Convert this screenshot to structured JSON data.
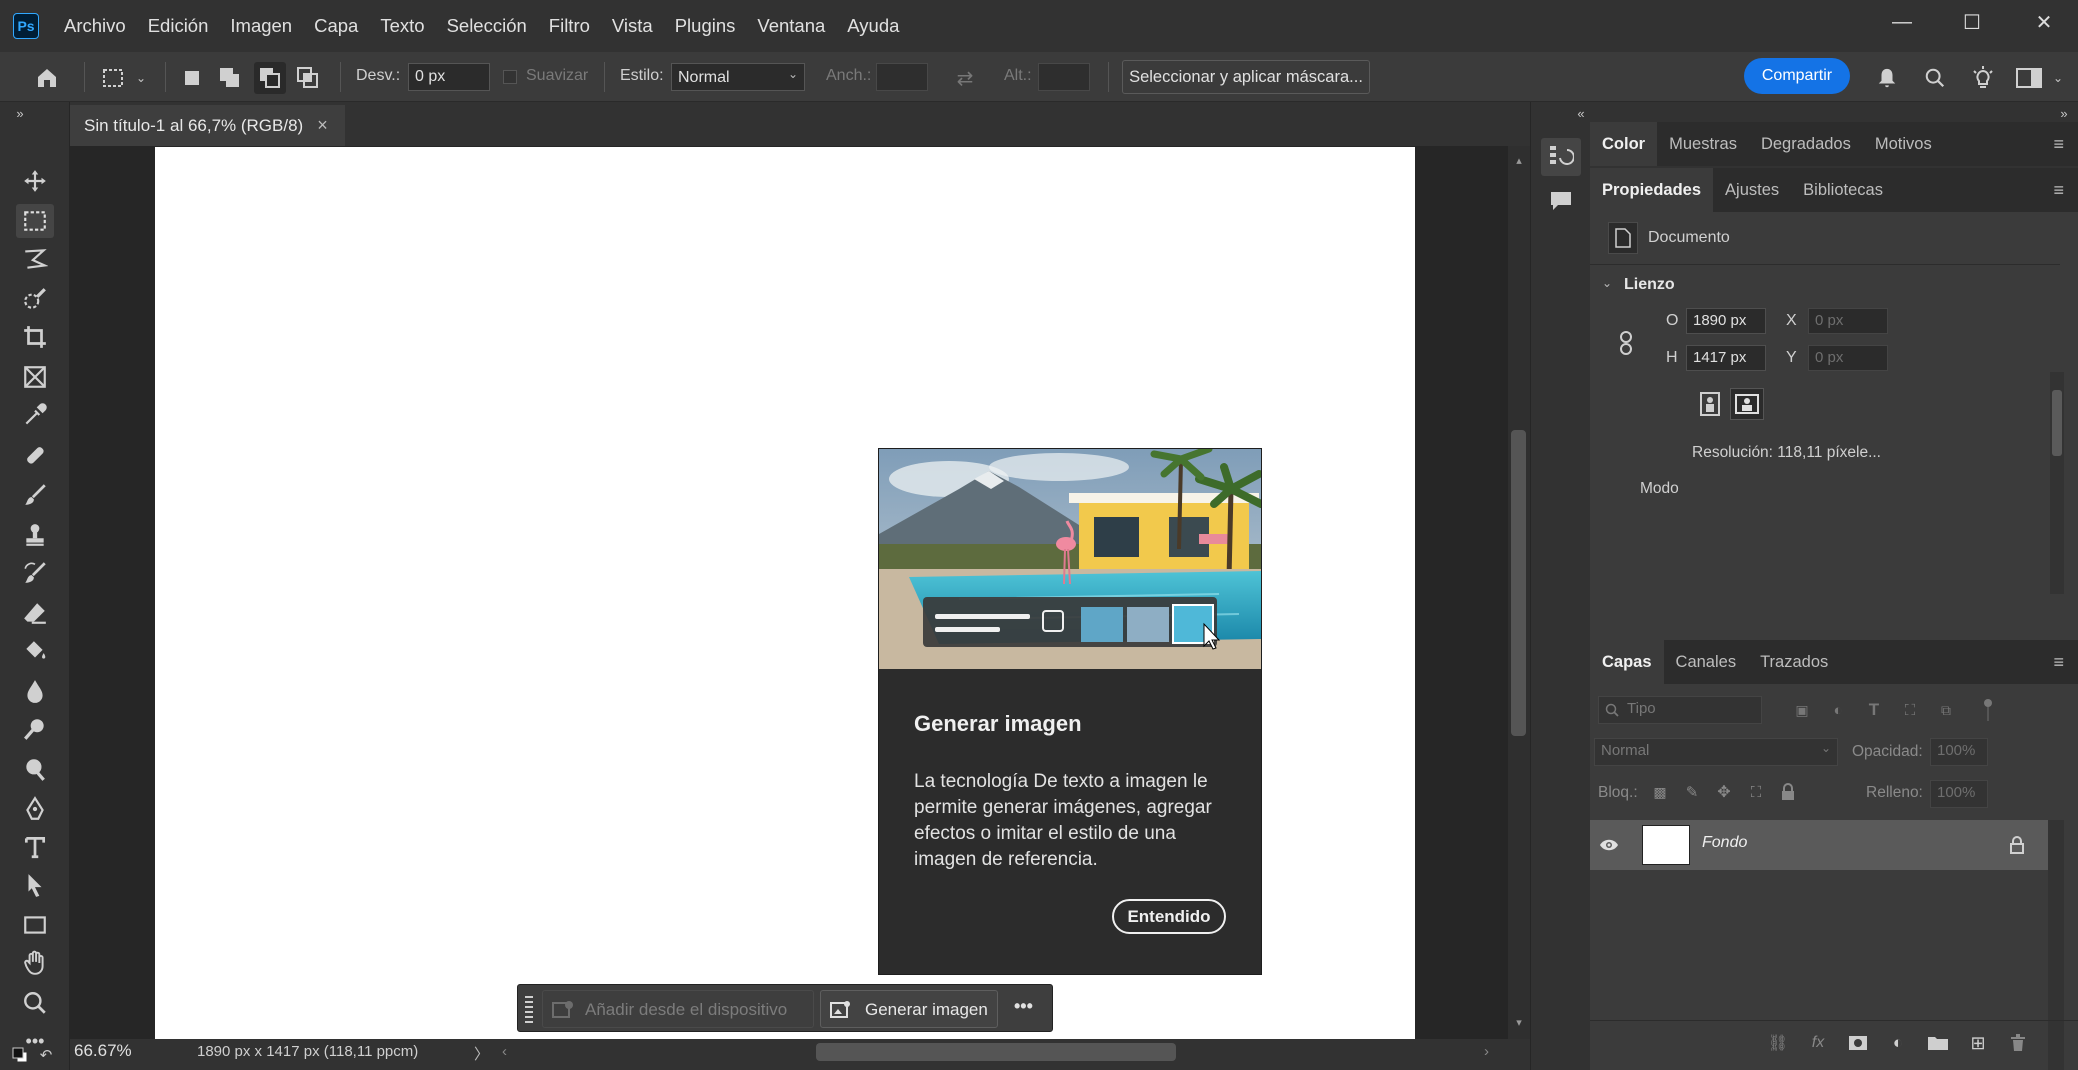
{
  "app": {
    "logo": "Ps"
  },
  "menu": [
    "Archivo",
    "Edición",
    "Imagen",
    "Capa",
    "Texto",
    "Selección",
    "Filtro",
    "Vista",
    "Plugins",
    "Ventana",
    "Ayuda"
  ],
  "window_controls": {
    "minimize": "—",
    "maximize": "☐",
    "close": "✕"
  },
  "options": {
    "feather_label": "Desv.:",
    "feather_value": "0 px",
    "antialias_label": "Suavizar",
    "style_label": "Estilo:",
    "style_value": "Normal",
    "width_label": "Anch.:",
    "height_label": "Alt.:",
    "select_mask_button": "Seleccionar y aplicar máscara...",
    "share_button": "Compartir"
  },
  "document": {
    "tab_title": "Sin título-1 al 66,7% (RGB/8)",
    "tab_close": "×",
    "zoom": "66.67%",
    "dimensions": "1890 px x 1417 px (118,11 ppcm)"
  },
  "popup": {
    "title": "Generar imagen",
    "body": "La tecnología De texto a imagen le permite generar imágenes, agregar efectos o imitar el estilo de una imagen de referencia.",
    "ok_button": "Entendido"
  },
  "context_bar": {
    "add_from_device": "Añadir desde el dispositivo",
    "generate_image": "Generar imagen",
    "more": "•••"
  },
  "panel_top": {
    "tabs": [
      "Color",
      "Muestras",
      "Degradados",
      "Motivos"
    ],
    "active": "Color"
  },
  "properties": {
    "tabs": [
      "Propiedades",
      "Ajustes",
      "Bibliotecas"
    ],
    "active": "Propiedades",
    "document_label": "Documento",
    "canvas_section": "Lienzo",
    "width_label": "O",
    "width_value": "1890 px",
    "height_label": "H",
    "height_value": "1417 px",
    "x_label": "X",
    "x_placeholder": "0 px",
    "y_label": "Y",
    "y_placeholder": "0 px",
    "resolution": "Resolución:  118,11  píxele...",
    "mode": "Modo"
  },
  "layers": {
    "tabs": [
      "Capas",
      "Canales",
      "Trazados"
    ],
    "active": "Capas",
    "search_placeholder": "Tipo",
    "blend_mode": "Normal",
    "opacity_label": "Opacidad:",
    "opacity_value": "100%",
    "lock_label": "Bloq.:",
    "fill_label": "Relleno:",
    "fill_value": "100%",
    "items": [
      {
        "name": "Fondo",
        "visible": true,
        "locked": true
      }
    ]
  },
  "colors": {
    "accent": "#1473e6",
    "ps_blue": "#31a8ff"
  }
}
